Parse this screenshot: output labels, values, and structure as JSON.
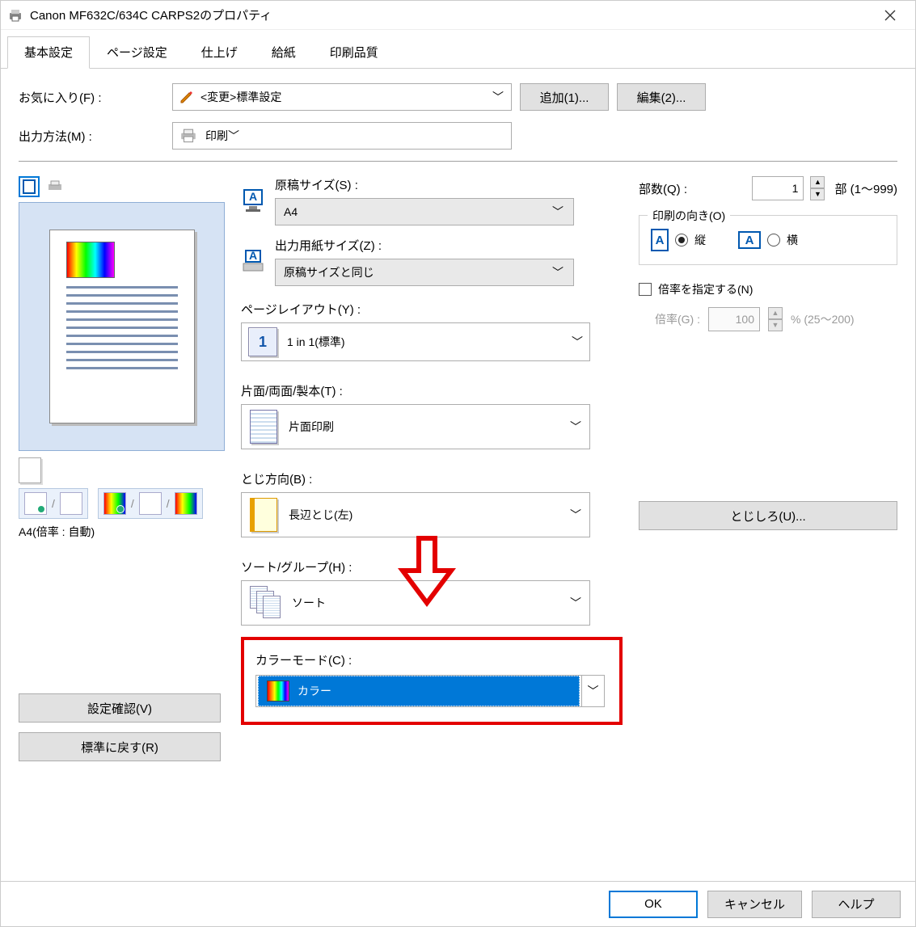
{
  "window": {
    "title": "Canon MF632C/634C CARPS2のプロパティ"
  },
  "tabs": [
    "基本設定",
    "ページ設定",
    "仕上げ",
    "給紙",
    "印刷品質"
  ],
  "active_tab": 0,
  "favorites": {
    "label": "お気に入り(F) :",
    "value": "<変更>標準設定",
    "add_btn": "追加(1)...",
    "edit_btn": "編集(2)..."
  },
  "output": {
    "label": "出力方法(M) :",
    "value": "印刷"
  },
  "preview": {
    "caption": "A4(倍率 : 自動)"
  },
  "original_size": {
    "label": "原稿サイズ(S) :",
    "value": "A4"
  },
  "output_size": {
    "label": "出力用紙サイズ(Z) :",
    "value": "原稿サイズと同じ"
  },
  "layout": {
    "label": "ページレイアウト(Y) :",
    "value": "1 in 1(標準)"
  },
  "duplex": {
    "label": "片面/両面/製本(T) :",
    "value": "片面印刷"
  },
  "binding": {
    "label": "とじ方向(B) :",
    "value": "長辺とじ(左)",
    "gutter_btn": "とじしろ(U)..."
  },
  "sort": {
    "label": "ソート/グループ(H) :",
    "value": "ソート"
  },
  "color": {
    "label": "カラーモード(C) :",
    "value": "カラー"
  },
  "copies": {
    "label": "部数(Q) :",
    "value": "1",
    "unit": "部 (1～999)"
  },
  "orientation": {
    "legend": "印刷の向き(O)",
    "portrait": "縦",
    "landscape": "横",
    "selected": "portrait"
  },
  "scale": {
    "check_label": "倍率を指定する(N)",
    "label": "倍率(G) :",
    "value": "100",
    "unit": "% (25～200)"
  },
  "left_buttons": {
    "confirm": "設定確認(V)",
    "reset": "標準に戻す(R)"
  },
  "bottom": {
    "ok": "OK",
    "cancel": "キャンセル",
    "help": "ヘルプ"
  }
}
